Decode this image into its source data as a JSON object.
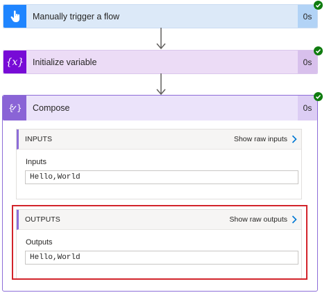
{
  "steps": [
    {
      "title": "Manually trigger a flow",
      "duration": "0s",
      "icon": "hand-tap-icon",
      "status": "succeeded"
    },
    {
      "title": "Initialize variable",
      "duration": "0s",
      "icon": "variable-icon",
      "icon_glyph": "{x}",
      "status": "succeeded"
    }
  ],
  "compose": {
    "title": "Compose",
    "duration": "0s",
    "icon": "compose-icon",
    "status": "succeeded",
    "inputs": {
      "section_label": "INPUTS",
      "raw_link": "Show raw inputs",
      "field_label": "Inputs",
      "value": "Hello,World"
    },
    "outputs": {
      "section_label": "OUTPUTS",
      "raw_link": "Show raw outputs",
      "field_label": "Outputs",
      "value": "Hello,World"
    }
  },
  "colors": {
    "success": "#107c10",
    "trigger": "#1f85ff",
    "variable": "#770bd6",
    "compose": "#8a64d6",
    "highlight": "#d2232a",
    "link_chevron": "#0078d4"
  }
}
